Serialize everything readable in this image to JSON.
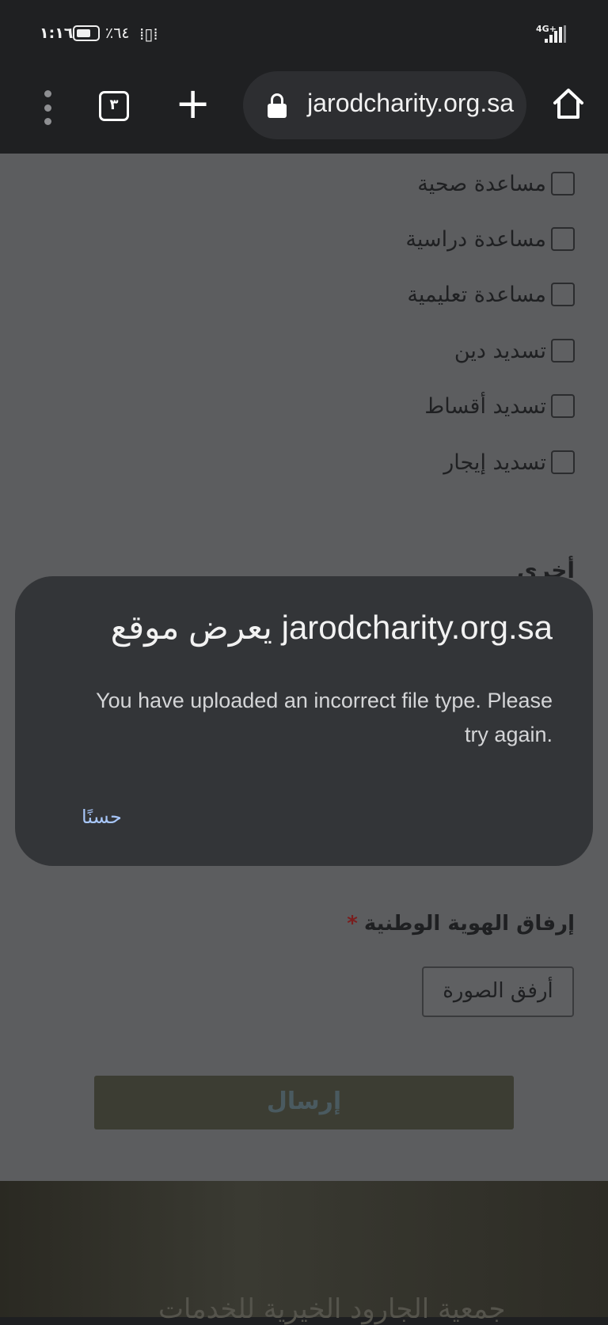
{
  "status_bar": {
    "time": "١:١٦",
    "battery_text": "٪٦٤",
    "battery_level": 0.64,
    "network": "4G+"
  },
  "browser": {
    "tab_count": "٣",
    "url": "jarodcharity.org.sa",
    "icons": [
      "more-vert-icon",
      "tab-switcher-icon",
      "new-tab-icon",
      "lock-icon",
      "home-icon"
    ]
  },
  "page": {
    "checkbox_options": [
      {
        "label": "مساعدة صحية",
        "checked": false
      },
      {
        "label": "مساعدة دراسية",
        "checked": false
      },
      {
        "label": "مساعدة تعليمية",
        "checked": false
      },
      {
        "label": "تسديد دين",
        "checked": false
      },
      {
        "label": "تسديد أقساط",
        "checked": false
      },
      {
        "label": "تسديد إيجار",
        "checked": false
      }
    ],
    "other_label": "أخرى",
    "national_id_label": "إرفاق الهوية الوطنية",
    "required_marker": "*",
    "attach_button": "أرفق الصورة",
    "submit_button": "إرسال",
    "footer_text": "جمعية الجارود الخيرية للخدمات"
  },
  "dialog": {
    "title": "يعرض موقع jarodcharity.org.sa",
    "message": "You have uploaded an incorrect file type. Please try again.",
    "ok_button": "حسنًا"
  },
  "colors": {
    "dialog_bg": "#333538",
    "link_blue": "#a8c7fa",
    "toolbar_bg": "#1f2022"
  }
}
